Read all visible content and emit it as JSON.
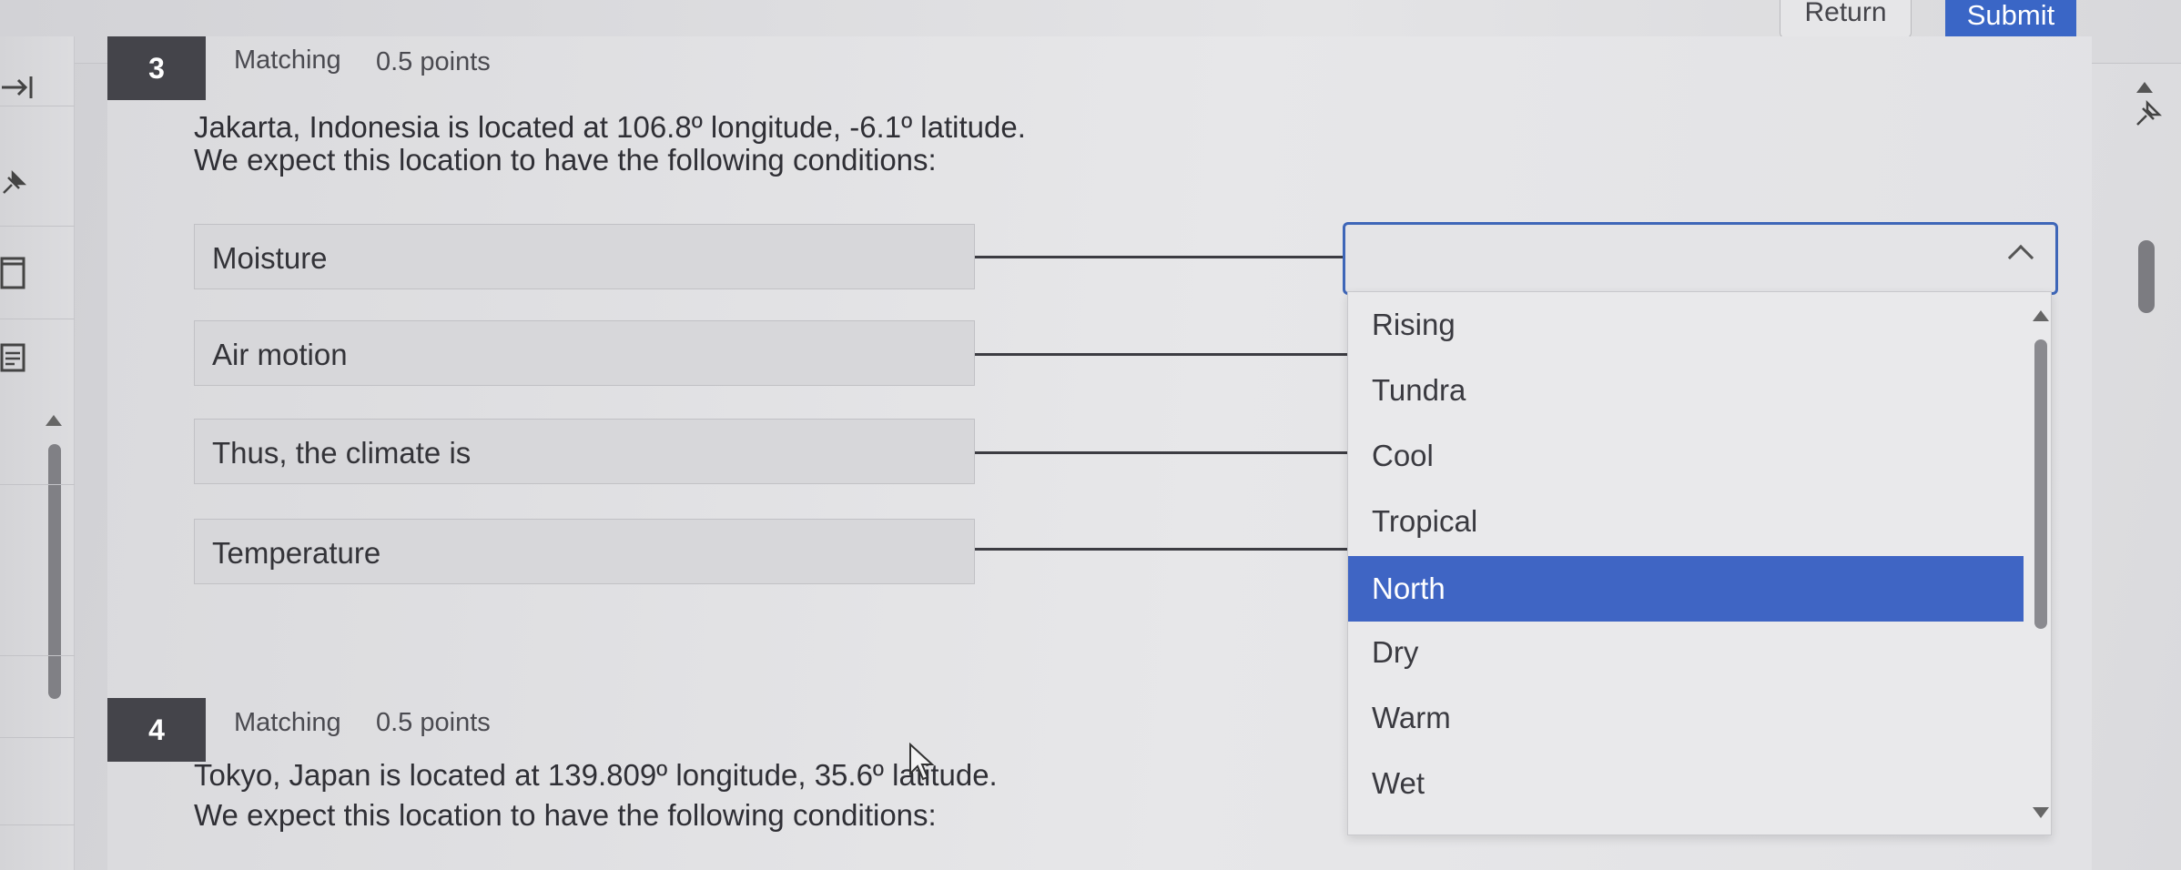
{
  "header": {
    "return_label": "Return",
    "submit_label": "Submit"
  },
  "questions": [
    {
      "number": "3",
      "type": "Matching",
      "points": "0.5 points",
      "text_line1": "Jakarta, Indonesia is located at 106.8º longitude, -6.1º latitude.",
      "text_line2": "We expect this location to have the following conditions:",
      "prompts": [
        "Moisture",
        "Air motion",
        "Thus, the climate is",
        "Temperature"
      ]
    },
    {
      "number": "4",
      "type": "Matching",
      "points": "0.5 points",
      "text_line1": "Tokyo, Japan is located at 139.809º longitude, 35.6º latitude.",
      "text_line2": "We expect this location to have the following conditions:"
    }
  ],
  "dropdown": {
    "selected_value": "",
    "highlighted": "North",
    "options": [
      "Rising",
      "Tundra",
      "Cool",
      "Tropical",
      "North",
      "Dry",
      "Warm",
      "Wet"
    ]
  },
  "icons": {
    "rail": [
      "collapse-right-icon",
      "pin-icon",
      "card-icon",
      "list-icon"
    ],
    "question_pin": "pin-icon"
  },
  "colors": {
    "accent": "#3a66c6",
    "highlight": "#3f65c4",
    "qnum_bg": "#44444a"
  }
}
